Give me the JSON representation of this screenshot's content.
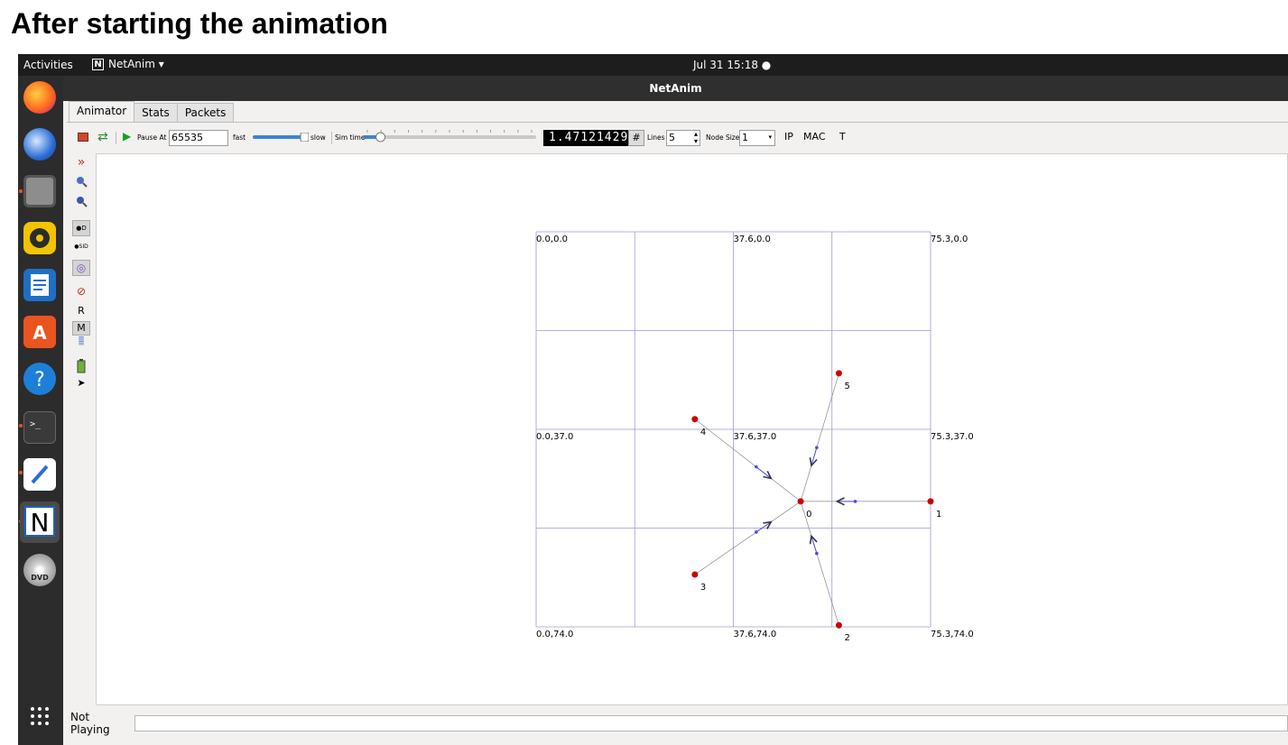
{
  "heading": "After starting the animation",
  "topbar": {
    "activities": "Activities",
    "app_name": "NetAnim ▾",
    "app_logo": "N",
    "clock": "Jul 31  15:18  ●"
  },
  "window": {
    "title": "NetAnim"
  },
  "tabs": [
    {
      "label": "Animator"
    },
    {
      "label": "Stats"
    },
    {
      "label": "Packets"
    }
  ],
  "toolbar": {
    "pause_at_label": "Pause At",
    "pause_at_value": "65535",
    "fast_label": "fast",
    "slow_label": "slow",
    "sim_time_label": "Sim time",
    "sim_time_value": "1.47121429",
    "grid_button": "#",
    "lines_label": "Lines",
    "lines_value": "5",
    "node_size_label": "Node Size",
    "node_size_value": "1",
    "ip_label": "IP",
    "mac_label": "MAC",
    "t_label": "T",
    "speed_fraction": 1.0,
    "sim_time_fraction": 0.08
  },
  "sidebar": {
    "r_label": "R",
    "m_label": "M"
  },
  "grid": {
    "labels": {
      "tl": "0.0,0.0",
      "tm": "37.6,0.0",
      "tr": "75.3,0.0",
      "ml": "0.0,37.0",
      "mm": "37.6,37.0",
      "mr": "75.3,37.0",
      "bl": "0.0,74.0",
      "bm": "37.6,74.0",
      "br": "75.3,74.0"
    }
  },
  "nodes": [
    {
      "id": "0",
      "x": 50.5,
      "y": 50.5
    },
    {
      "id": "1",
      "x": 75.3,
      "y": 50.5
    },
    {
      "id": "2",
      "x": 57.8,
      "y": 73.7
    },
    {
      "id": "3",
      "x": 30.3,
      "y": 64.2
    },
    {
      "id": "4",
      "x": 30.3,
      "y": 35.1
    },
    {
      "id": "5",
      "x": 57.8,
      "y": 26.5
    }
  ],
  "status": {
    "text": "Not Playing",
    "value": ""
  },
  "colors": {
    "node": "#cc0000",
    "grid": "#9a9ad6",
    "packet": "#4a4ae0",
    "arrow": "#33334d"
  }
}
